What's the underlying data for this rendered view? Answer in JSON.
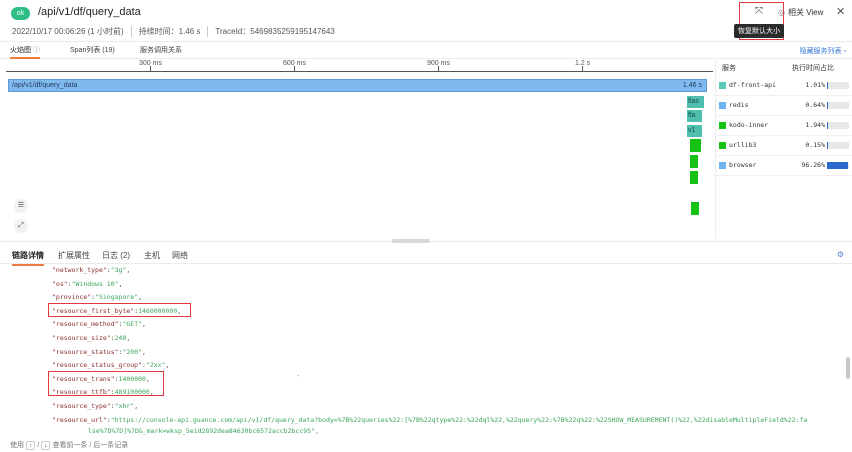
{
  "header": {
    "status": "ok",
    "title": "/api/v1/df/query_data",
    "timestamp": "2022/10/17 00:06:26 (1 小时前)",
    "duration": "持续时间：1.46 s",
    "trace_id": "TraceId：5469835259195147643",
    "restore_tooltip": "恢复默认大小",
    "related_view": "相关 View"
  },
  "tabs": [
    {
      "label": "火焰图"
    },
    {
      "label": "Span列表 (19)"
    },
    {
      "label": "服务调用关系"
    }
  ],
  "hide_service_list": "隐藏服务列表",
  "ruler_ticks": [
    "300 ms",
    "600 ms",
    "900 ms",
    "1.2 s"
  ],
  "flame": {
    "root_label": "/api/v1/df/query_data",
    "root_duration": "1.46 s",
    "sub_labels": [
      "flas",
      "fla",
      "v1"
    ]
  },
  "services": {
    "header_service": "服务",
    "header_pct": "执行时间占比",
    "rows": [
      {
        "name": "df-front-api",
        "pct": "1.01%",
        "value": 1.01,
        "color": "#5cc9b8"
      },
      {
        "name": "redis",
        "pct": "0.64%",
        "value": 0.64,
        "color": "#6db3f2"
      },
      {
        "name": "kodo-inner",
        "pct": "1.94%",
        "value": 1.94,
        "color": "#15c315"
      },
      {
        "name": "urllib3",
        "pct": "0.15%",
        "value": 0.15,
        "color": "#15c315"
      },
      {
        "name": "browser",
        "pct": "96.26%",
        "value": 96.26,
        "color": "#6db3f2"
      }
    ]
  },
  "bottom_tabs": [
    {
      "label": "链路详情"
    },
    {
      "label": "扩展属性"
    },
    {
      "label": "日志 (2)"
    },
    {
      "label": "主机"
    },
    {
      "label": "网络"
    }
  ],
  "json_lines": [
    {
      "key": "\"network_type\"",
      "val": "\"3g\"",
      "end": ","
    },
    {
      "key": "\"os\"",
      "val": "\"Windows 10\"",
      "end": ","
    },
    {
      "key": "\"province\"",
      "val": "\"Singapore\"",
      "end": ","
    },
    {
      "key": "\"resource_first_byte\"",
      "val": "1460000000",
      "end": ","
    },
    {
      "key": "\"resource_method\"",
      "val": "\"GET\"",
      "end": ","
    },
    {
      "key": "\"resource_size\"",
      "val": "240",
      "end": ","
    },
    {
      "key": "\"resource_status\"",
      "val": "\"200\"",
      "end": ","
    },
    {
      "key": "\"resource_status_group\"",
      "val": "\"2xx\"",
      "end": ","
    },
    {
      "key": "\"resource_trans\"",
      "val": "1400000",
      "end": ","
    },
    {
      "key": "\"resource_ttfb\"",
      "val": "489100000",
      "end": ","
    },
    {
      "key": "\"resource_type\"",
      "val": "\"xhr\"",
      "end": ","
    },
    {
      "key": "\"resource_url\"",
      "val": "\"https://console-api.guance.com/api/v1/df/query_data?body=%7B%22queries%22:[%7B%22qtype%22:%22dql%22,%22query%22:%7B%22q%22:%22SHOW_MEASUREMENT()%22,%22disableMultipleField%22:fa",
      "end": ""
    }
  ],
  "json_cont": "lse%7D%7D]%7D&_mark=wksp_5e1d2892dea84630bc6572accb2bcc95\",",
  "dash_mark": "-",
  "footer": {
    "use": "使用",
    "up": "↑",
    "sep": "/",
    "down": "↓",
    "hint": "查看前一条 / 后一条记录"
  }
}
